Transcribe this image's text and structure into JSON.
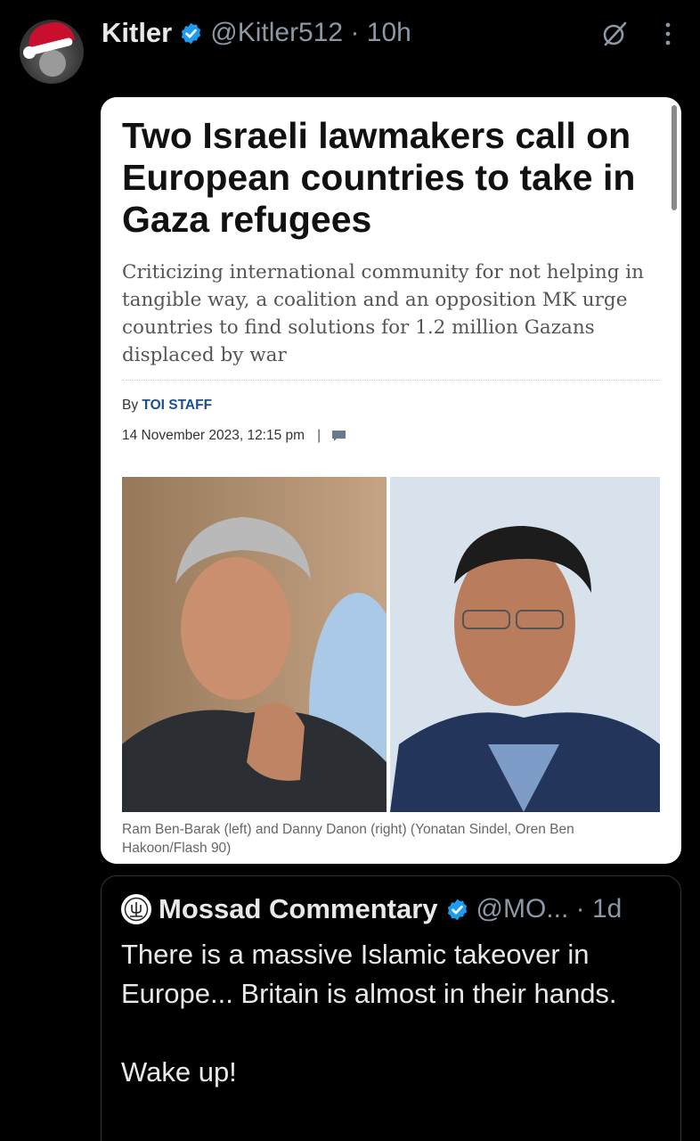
{
  "tweet": {
    "display_name": "Kitler",
    "handle_time": "@Kitler512 · 10h",
    "avatar_icon": "santa-hat-avatar-icon",
    "verified_icon": "verified-badge-icon",
    "grok_icon": "grok-icon",
    "more_icon": "more-vertical-icon"
  },
  "article": {
    "headline": "Two Israeli lawmakers call on European countries to take in Gaza refugees",
    "dek": "Criticizing international community for not helping in tangible way, a coalition and an opposition MK urge countries to find solutions for 1.2 million Gazans displaced by war",
    "by_label": "By",
    "author": "TOI STAFF",
    "date": "14 November 2023, 12:15 pm",
    "separator": "|",
    "caption": "Ram Ben-Barak (left) and Danny Danon (right) (Yonatan Sindel, Oren Ben Hakoon/Flash 90)"
  },
  "quoted_tweet": {
    "display_name": "Mossad Commentary",
    "handle_time": "@MO... · 1d",
    "body_line1": "There is a massive Islamic takeover in Europe... Britain is almost in their hands.",
    "body_line2": "Wake up!"
  },
  "colors": {
    "background": "#000000",
    "verified_blue": "#1d9bf0",
    "muted": "#8b98a5",
    "toi_blue": "#1a4f96"
  }
}
